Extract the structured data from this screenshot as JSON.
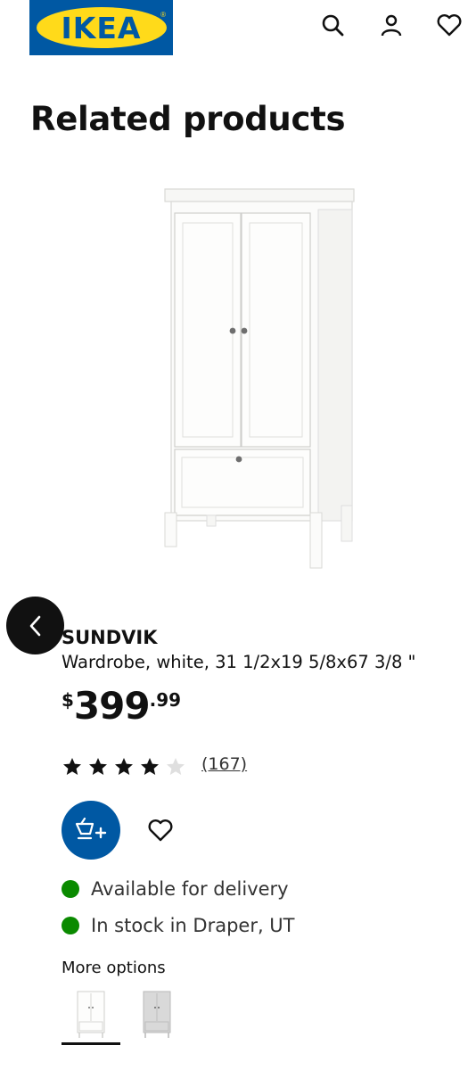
{
  "header": {
    "logo_text": "IKEA",
    "logo_reg": "®",
    "icons": [
      "search-icon",
      "user-icon",
      "heart-icon"
    ]
  },
  "section": {
    "title": "Related products"
  },
  "product": {
    "brand": "SUNDVIK",
    "description": "Wardrobe, white, 31 1/2x19 5/8x67 3/8 \"",
    "price": {
      "currency": "$",
      "integer": "399",
      "decimal": ".99"
    },
    "rating": {
      "value": 4,
      "max": 5
    },
    "reviews": "(167)",
    "availability": [
      {
        "text": "Available for delivery",
        "color": "#0a8a00"
      },
      {
        "text": "In stock in Draper, UT",
        "color": "#0a8a00"
      }
    ],
    "more_options_label": "More options"
  },
  "colors": {
    "ikea_blue": "#0058a3",
    "ikea_yellow": "#ffda1a",
    "stock_green": "#0a8a00"
  }
}
